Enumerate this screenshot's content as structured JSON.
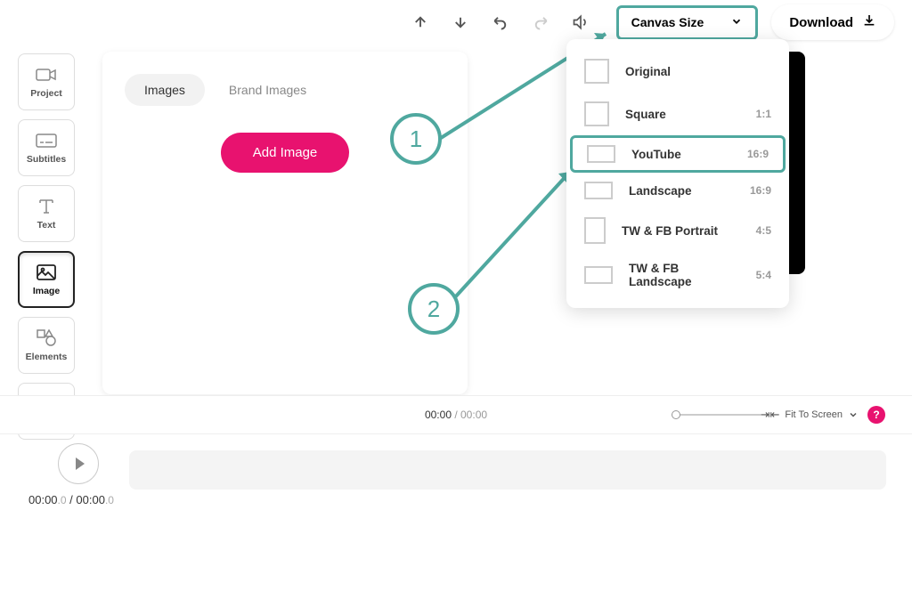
{
  "topbar": {
    "canvas_size_label": "Canvas Size",
    "download_label": "Download"
  },
  "sidebar": {
    "items": [
      {
        "label": "Project"
      },
      {
        "label": "Subtitles"
      },
      {
        "label": "Text"
      },
      {
        "label": "Image"
      },
      {
        "label": "Elements"
      }
    ]
  },
  "panel": {
    "tabs": [
      {
        "label": "Images"
      },
      {
        "label": "Brand Images"
      }
    ],
    "add_button": "Add Image"
  },
  "canvas_sizes": [
    {
      "label": "Original",
      "ratio": ""
    },
    {
      "label": "Square",
      "ratio": "1:1"
    },
    {
      "label": "YouTube",
      "ratio": "16:9"
    },
    {
      "label": "Landscape",
      "ratio": "16:9"
    },
    {
      "label": "TW & FB Portrait",
      "ratio": "4:5"
    },
    {
      "label": "TW & FB Landscape",
      "ratio": "5:4"
    }
  ],
  "callouts": {
    "one": "1",
    "two": "2"
  },
  "playbar": {
    "current": "00:00",
    "separator": " / ",
    "total": "00:00",
    "fit_label": "Fit To Screen",
    "help": "?"
  },
  "timeline": {
    "current": "00:00",
    "current_frac": ".0",
    "sep": " / ",
    "total": "00:00",
    "total_frac": ".0"
  }
}
